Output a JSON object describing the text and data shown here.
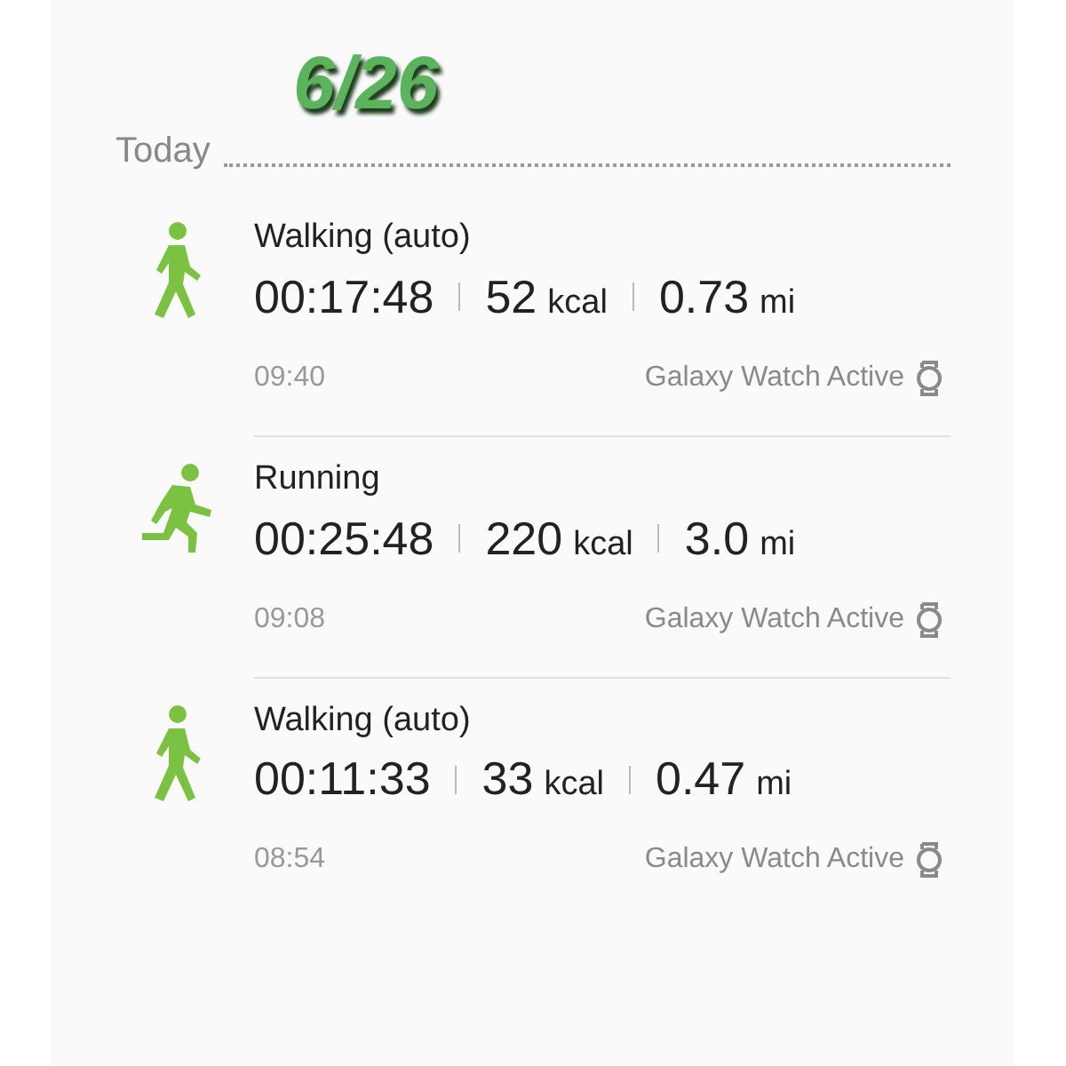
{
  "date_overlay": "6/26",
  "section": {
    "label": "Today"
  },
  "activities": [
    {
      "kind": "walking",
      "title": "Walking (auto)",
      "duration": "00:17:48",
      "calories": "52",
      "calories_unit": "kcal",
      "distance": "0.73",
      "distance_unit": "mi",
      "time": "09:40",
      "device": "Galaxy Watch Active"
    },
    {
      "kind": "running",
      "title": "Running",
      "duration": "00:25:48",
      "calories": "220",
      "calories_unit": "kcal",
      "distance": "3.0",
      "distance_unit": "mi",
      "time": "09:08",
      "device": "Galaxy Watch Active"
    },
    {
      "kind": "walking",
      "title": "Walking (auto)",
      "duration": "00:11:33",
      "calories": "33",
      "calories_unit": "kcal",
      "distance": "0.47",
      "distance_unit": "mi",
      "time": "08:54",
      "device": "Galaxy Watch Active"
    }
  ]
}
